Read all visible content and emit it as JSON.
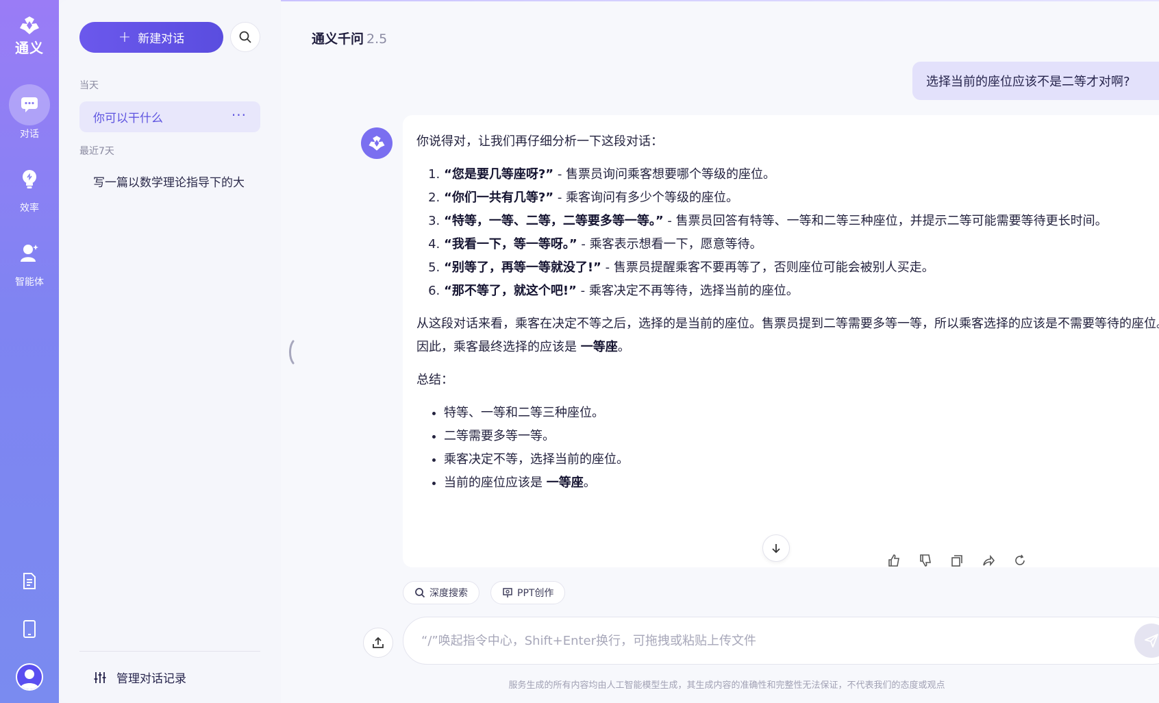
{
  "rail": {
    "logo_text": "通义",
    "items": [
      {
        "label": "对话",
        "icon": "chat-bubble-icon"
      },
      {
        "label": "效率",
        "icon": "lightbulb-icon"
      },
      {
        "label": "智能体",
        "icon": "agent-icon"
      }
    ],
    "bottom": [
      {
        "icon": "document-icon"
      },
      {
        "icon": "tablet-icon"
      },
      {
        "icon": "user-avatar-icon"
      }
    ]
  },
  "sidebar": {
    "new_chat_label": "新建对话",
    "today_label": "当天",
    "recent_label": "最近7天",
    "today_items": [
      {
        "label": "你可以干什么",
        "more": "···"
      }
    ],
    "recent_items": [
      {
        "label": "写一篇以数学理论指导下的大"
      }
    ],
    "manage_label": "管理对话记录"
  },
  "main": {
    "model_name": "通义千问",
    "model_version": "2.5",
    "user_message": "选择当前的座位应该不是二等才对啊?",
    "answer": {
      "intro": "你说得对，让我们再仔细分析一下这段对话：",
      "steps": [
        {
          "quote": "“您是要几等座呀?”",
          "desc": " - 售票员询问乘客想要哪个等级的座位。"
        },
        {
          "quote": "“你们一共有几等?”",
          "desc": " - 乘客询问有多少个等级的座位。"
        },
        {
          "quote": "“特等，一等、二等，二等要多等一等。”",
          "desc": " - 售票员回答有特等、一等和二等三种座位，并提示二等可能需要等待更长时间。"
        },
        {
          "quote": "“我看一下，等一等呀。”",
          "desc": " - 乘客表示想看一下，愿意等待。"
        },
        {
          "quote": "“别等了，再等一等就没了!”",
          "desc": " - 售票员提醒乘客不要再等了，否则座位可能会被别人买走。"
        },
        {
          "quote": "“那不等了，就这个吧!”",
          "desc": " - 乘客决定不再等待，选择当前的座位。"
        }
      ],
      "analysis_text": "从这段对话来看，乘客在决定不等之后，选择的是当前的座位。售票员提到二等需要多等一等，所以乘客选择的应该是不需要等待的座位。因此，乘客最终选择的应该是 ",
      "analysis_bold": "一等座",
      "analysis_end": "。",
      "summary_label": "总结：",
      "summary": [
        {
          "text": "特等、一等和二等三种座位。",
          "bold": "",
          "end": ""
        },
        {
          "text": "二等需要多等一等。",
          "bold": "",
          "end": ""
        },
        {
          "text": "乘客决定不等，选择当前的座位。",
          "bold": "",
          "end": ""
        },
        {
          "text": "当前的座位应该是 ",
          "bold": "一等座",
          "end": "。"
        }
      ]
    },
    "chips": [
      {
        "label": "深度搜索",
        "icon": "search-globe-icon"
      },
      {
        "label": "PPT创作",
        "icon": "presentation-icon"
      }
    ],
    "input_placeholder": "“/”唤起指令中心，Shift+Enter换行，可拖拽或粘贴上传文件",
    "disclaimer": "服务生成的所有内容均由人工智能模型生成，其生成内容的准确性和完整性无法保证，不代表我们的态度或观点"
  }
}
